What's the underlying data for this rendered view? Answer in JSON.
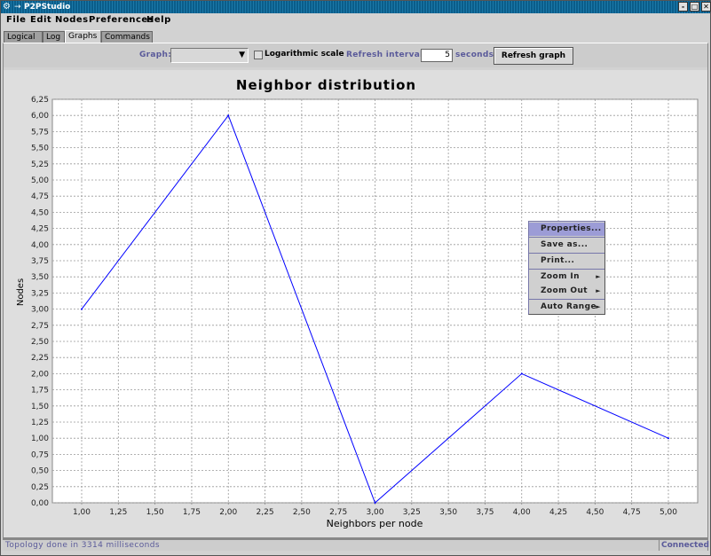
{
  "window": {
    "title": "P2PStudio",
    "icon": "app-icon",
    "controls": {
      "minimize": "-",
      "maximize": "□",
      "close": "✕"
    }
  },
  "menubar": {
    "items": [
      "File",
      "Edit",
      "Nodes",
      "Preferences",
      "Help"
    ]
  },
  "tabs": [
    {
      "label": "Logical",
      "active": false
    },
    {
      "label": "Log",
      "active": false
    },
    {
      "label": "Graphs",
      "active": true
    },
    {
      "label": "Commands",
      "active": false
    }
  ],
  "toolbar": {
    "graph_label": "Graph:",
    "graph_value": "",
    "log_scale_label": "Logarithmic scale",
    "log_scale_checked": false,
    "refresh_interval_label": "Refresh interval:",
    "refresh_interval_value": "5",
    "seconds_label": "seconds",
    "refresh_button_label": "Refresh graph"
  },
  "chart_data": {
    "type": "line",
    "title": "Neighbor distribution",
    "xlabel": "Neighbors per node",
    "ylabel": "Nodes",
    "x": [
      1,
      2,
      3,
      4,
      5
    ],
    "series": [
      {
        "name": "Nodes",
        "values": [
          3,
          6,
          0,
          2,
          1
        ],
        "color": "#0000ff"
      }
    ],
    "xlim": [
      0.8,
      5.55
    ],
    "ylim": [
      0,
      6.25
    ],
    "xticks": [
      "1,00",
      "1,25",
      "1,50",
      "1,75",
      "2,00",
      "2,25",
      "2,50",
      "2,75",
      "3,00",
      "3,25",
      "3,50",
      "3,75",
      "4,00",
      "4,25",
      "4,50",
      "4,75",
      "5,00"
    ],
    "xtick_values": [
      1,
      1.25,
      1.5,
      1.75,
      2,
      2.25,
      2.5,
      2.75,
      3,
      3.25,
      3.5,
      3.75,
      4,
      4.25,
      4.5,
      4.75,
      5
    ],
    "yticks": [
      "0,00",
      "0,25",
      "0,50",
      "0,75",
      "1,00",
      "1,25",
      "1,50",
      "1,75",
      "2,00",
      "2,25",
      "2,50",
      "2,75",
      "3,00",
      "3,25",
      "3,50",
      "3,75",
      "4,00",
      "4,25",
      "4,50",
      "4,75",
      "5,00",
      "5,25",
      "5,50",
      "5,75",
      "6,00",
      "6,25"
    ],
    "ytick_values": [
      0,
      0.25,
      0.5,
      0.75,
      1,
      1.25,
      1.5,
      1.75,
      2,
      2.25,
      2.5,
      2.75,
      3,
      3.25,
      3.5,
      3.75,
      4,
      4.25,
      4.5,
      4.75,
      5,
      5.25,
      5.5,
      5.75,
      6,
      6.25
    ],
    "grid": true,
    "legend": "none"
  },
  "context_menu": {
    "items": [
      {
        "label": "Properties...",
        "highlighted": true,
        "submenu": false
      },
      {
        "label": "Save as...",
        "highlighted": false,
        "submenu": false
      },
      {
        "label": "Print...",
        "highlighted": false,
        "submenu": false
      },
      {
        "label": "Zoom In",
        "highlighted": false,
        "submenu": true
      },
      {
        "label": "Zoom Out",
        "highlighted": false,
        "submenu": true
      },
      {
        "label": "Auto Range",
        "highlighted": false,
        "submenu": true
      }
    ],
    "submenu_glyph": "►"
  },
  "statusbar": {
    "message": "Topology done in 3314 milliseconds",
    "connection": "Connected"
  }
}
